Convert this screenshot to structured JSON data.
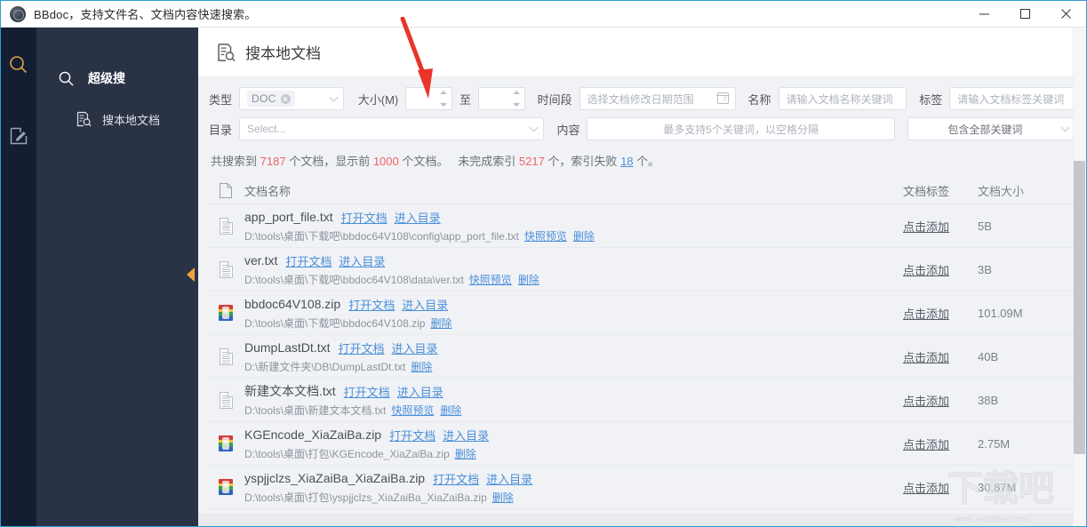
{
  "window": {
    "title": "BBdoc，支持文件名、文档内容快速搜索。",
    "logo_icon": "bbdoc-logo-icon",
    "controls": {
      "minimize": "minimize-icon",
      "maximize": "maximize-icon",
      "close": "close-icon"
    }
  },
  "rail": {
    "items": [
      {
        "icon": "search-icon",
        "active": true
      },
      {
        "icon": "edit-note-icon",
        "active": false
      }
    ]
  },
  "sidebar": {
    "group": {
      "label": "超级搜",
      "icon": "search-icon"
    },
    "items": [
      {
        "label": "搜本地文档",
        "icon": "document-search-icon",
        "active": true
      }
    ],
    "collapse_handle": "collapse-left-icon"
  },
  "header": {
    "icon": "document-search-icon",
    "title": "搜本地文档"
  },
  "filters": {
    "type": {
      "label": "类型",
      "tag": "DOC",
      "tag_remove_icon": "remove-tag-icon",
      "caret_icon": "chevron-down-icon"
    },
    "size": {
      "label": "大小(M)",
      "from_value": "",
      "to_label": "至",
      "to_value": "",
      "stepper_up_icon": "stepper-up-icon",
      "stepper_down_icon": "stepper-down-icon"
    },
    "date": {
      "label": "时间段",
      "placeholder": "选择文档修改日期范围",
      "icon": "calendar-icon"
    },
    "name": {
      "label": "名称",
      "placeholder": "请输入文档名称关键词",
      "value": ""
    },
    "tagfield": {
      "label": "标签",
      "placeholder": "请输入文档标签关键词",
      "value": ""
    },
    "directory": {
      "label": "目录",
      "placeholder": "Select...",
      "caret_icon": "chevron-down-icon"
    },
    "content": {
      "label": "内容",
      "placeholder": "最多支持5个关键词，以空格分隔",
      "value": ""
    },
    "match_mode": {
      "value": "包含全部关键词",
      "caret_icon": "chevron-down-icon"
    }
  },
  "summary": {
    "prefix": "共搜索到",
    "total": "7187",
    "mid1": "个文档，显示前",
    "shown": "1000",
    "mid2": "个文档。",
    "mid3": "未完成索引",
    "pending": "5217",
    "mid4": "个，索引失败",
    "failed": "18",
    "suffix": "个。"
  },
  "table": {
    "headers": {
      "icon": "file-icon-column",
      "name": "文档名称",
      "tag": "文档标签",
      "size": "文档大小"
    },
    "actions": {
      "open": "打开文档",
      "goto": "进入目录",
      "preview": "快照预览",
      "delete": "删除",
      "add_tag": "点击添加"
    },
    "rows": [
      {
        "icon": "txt-file-icon",
        "name": "app_port_file.txt",
        "path": "D:\\tools\\桌面\\下载吧\\bbdoc64V108\\config\\app_port_file.txt",
        "has_preview": true,
        "tag": "点击添加",
        "size": "5B"
      },
      {
        "icon": "txt-file-icon",
        "name": "ver.txt",
        "path": "D:\\tools\\桌面\\下载吧\\bbdoc64V108\\data\\ver.txt",
        "has_preview": true,
        "tag": "点击添加",
        "size": "3B"
      },
      {
        "icon": "zip-file-icon",
        "name": "bbdoc64V108.zip",
        "path": "D:\\tools\\桌面\\下载吧\\bbdoc64V108.zip",
        "has_preview": false,
        "tag": "点击添加",
        "size": "101.09M"
      },
      {
        "icon": "txt-file-icon",
        "name": "DumpLastDt.txt",
        "path": "D:\\新建文件夹\\DB\\DumpLastDt.txt",
        "has_preview": false,
        "tag": "点击添加",
        "size": "40B"
      },
      {
        "icon": "txt-file-icon",
        "name": "新建文本文档.txt",
        "path": "D:\\tools\\桌面\\新建文本文档.txt",
        "has_preview": true,
        "tag": "点击添加",
        "size": "38B"
      },
      {
        "icon": "zip-file-icon",
        "name": "KGEncode_XiaZaiBa.zip",
        "path": "D:\\tools\\桌面\\打包\\KGEncode_XiaZaiBa.zip",
        "has_preview": false,
        "tag": "点击添加",
        "size": "2.75M"
      },
      {
        "icon": "zip-file-icon",
        "name": "yspjjclzs_XiaZaiBa_XiaZaiBa.zip",
        "path": "D:\\tools\\桌面\\打包\\yspjjclzs_XiaZaiBa_XiaZaiBa.zip",
        "has_preview": false,
        "tag": "点击添加",
        "size": "30.87M"
      }
    ]
  },
  "watermark": {
    "glyph": "下载吧",
    "url": "www.xiazaiba.com"
  },
  "annotation": {
    "arrow": "red-arrow-annotation"
  },
  "colors": {
    "accent": "#f0a53c",
    "link": "#4a90d9",
    "sidebar": "#2a3346",
    "rail": "#141e33",
    "danger": "#f06363",
    "window_border": "#2f9fd0"
  }
}
